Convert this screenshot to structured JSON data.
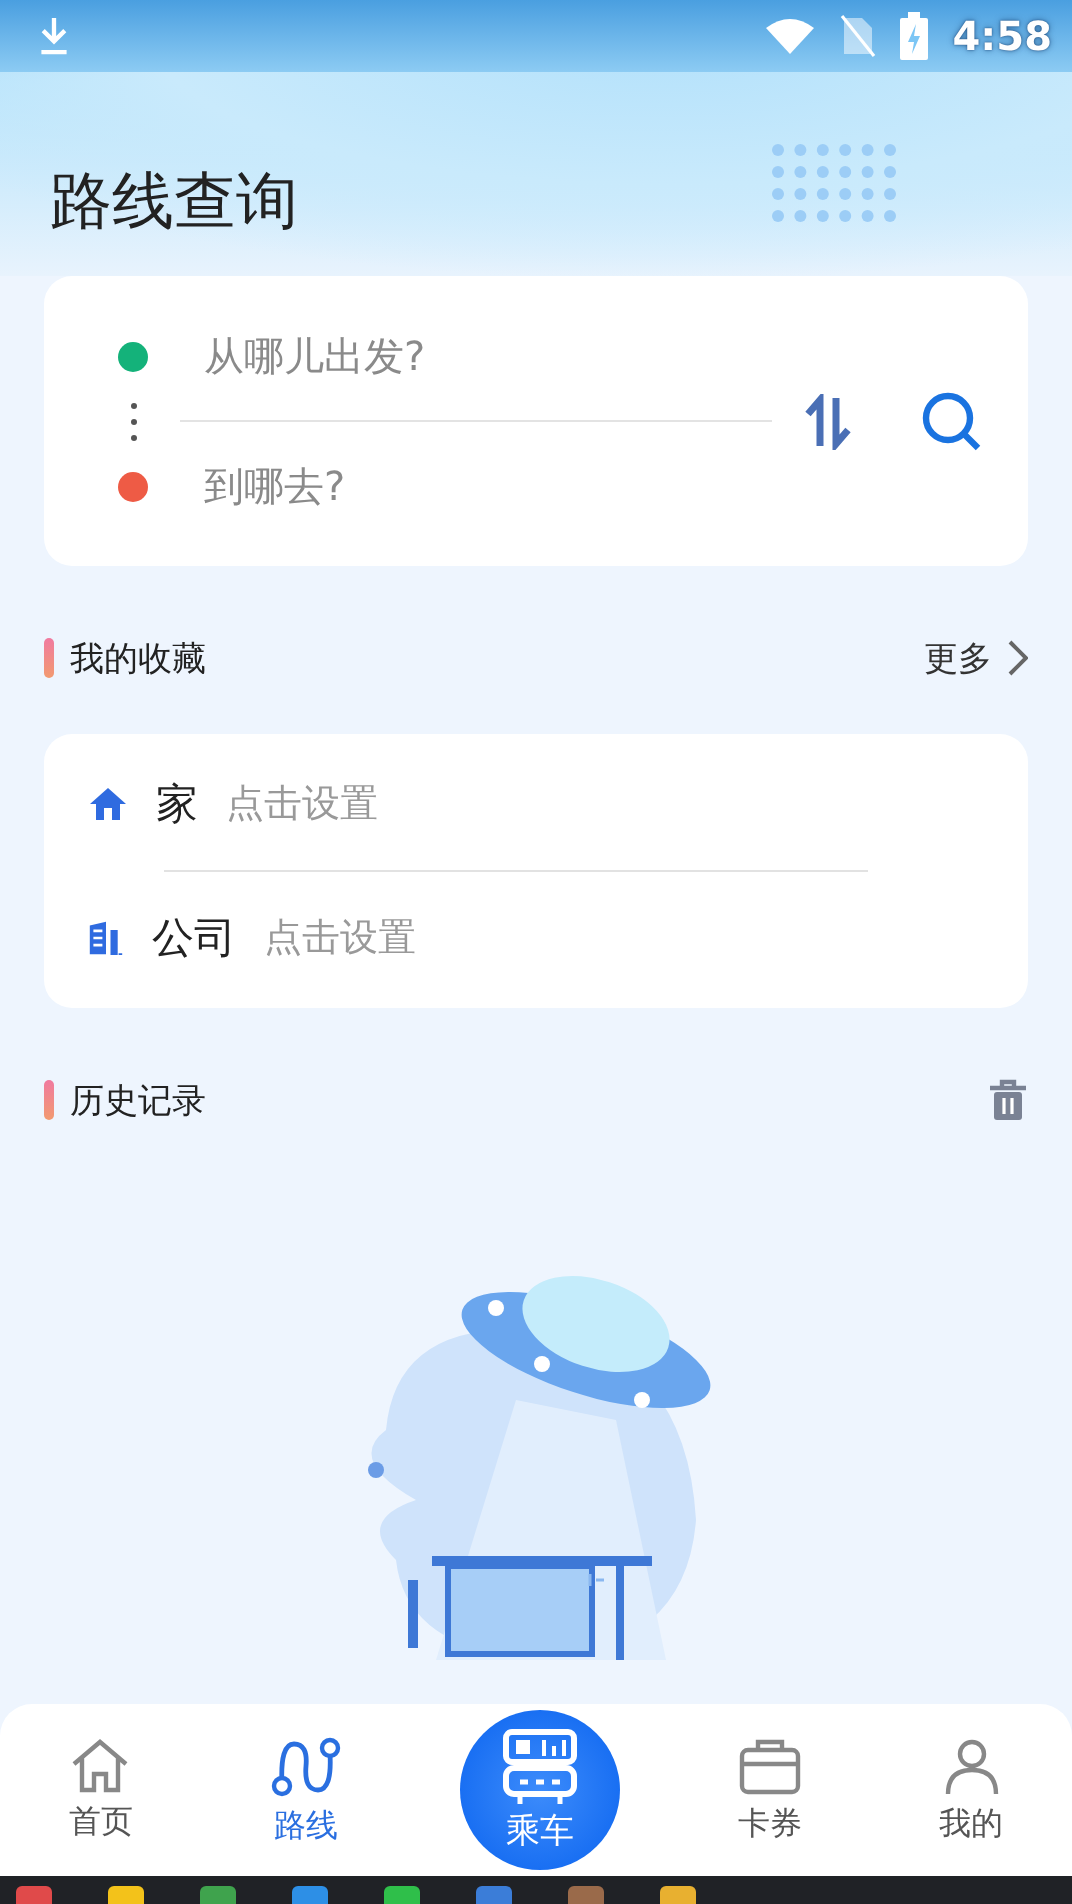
{
  "status_bar": {
    "time": "4:58"
  },
  "title": "路线查询",
  "route_search": {
    "from_placeholder": "从哪儿出发?",
    "to_placeholder": "到哪去?"
  },
  "favorites": {
    "title": "我的收藏",
    "more": "更多",
    "items": [
      {
        "kind": "home",
        "label": "家",
        "hint": "点击设置"
      },
      {
        "kind": "company",
        "label": "公司",
        "hint": "点击设置"
      }
    ]
  },
  "history": {
    "title": "历史记录"
  },
  "nav": [
    {
      "kind": "home",
      "label": "首页",
      "selected": false
    },
    {
      "kind": "route",
      "label": "路线",
      "selected": true
    },
    {
      "kind": "ride",
      "label": "乘车",
      "selected": false
    },
    {
      "kind": "card",
      "label": "卡券",
      "selected": false
    },
    {
      "kind": "me",
      "label": "我的",
      "selected": false
    }
  ]
}
